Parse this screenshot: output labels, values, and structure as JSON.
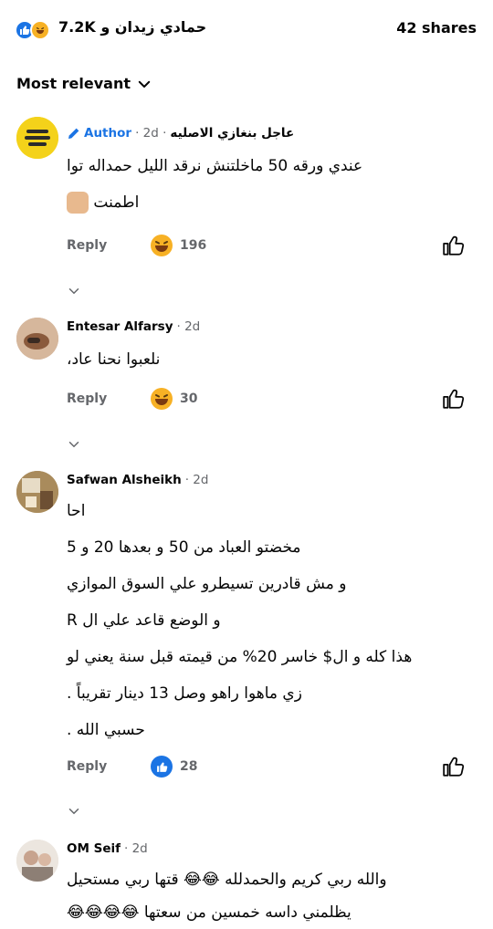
{
  "top": {
    "names": "حمادي زيدان و 7.2K",
    "shares": "42 shares"
  },
  "sort": {
    "label": "Most relevant"
  },
  "comments": [
    {
      "name": "عاجل بنغازي الاصليه",
      "time": "· 2d ·",
      "badge": "Author",
      "lines": [
        "عندي ورقه 50 ماخلتنش نرقد الليل حمداله توا",
        "اطمنت"
      ],
      "reply": "Reply",
      "reaction_count": "196",
      "reaction_type": "haha"
    },
    {
      "name": "Entesar Alfarsy",
      "time": "· 2d",
      "lines": [
        "نلعبوا نحنا عاد،"
      ],
      "reply": "Reply",
      "reaction_count": "30",
      "reaction_type": "haha"
    },
    {
      "name": "Safwan Alsheikh",
      "time": "· 2d",
      "lines": [
        "احا",
        "مخضتو العباد من 50 و بعدها 20 و 5",
        "و مش قادرين تسيطرو علي السوق الموازي",
        "و الوضع قاعد علي ال R",
        "هذا كله و ال$ خاسر 20% من قيمته قبل سنة يعني لو",
        "زي ماهوا راهو وصل 13 دينار تقريباً .",
        "حسبي الله ."
      ],
      "reply": "Reply",
      "reaction_count": "28",
      "reaction_type": "like"
    },
    {
      "name": "OM Seif",
      "time": "· 2d",
      "lines": [
        "والله ربي كريم والحمدلله 😂😂  قتها ربي مستحيل",
        "يظلمني داسه خمسين من سعتها 😂😂😂😂"
      ]
    }
  ]
}
